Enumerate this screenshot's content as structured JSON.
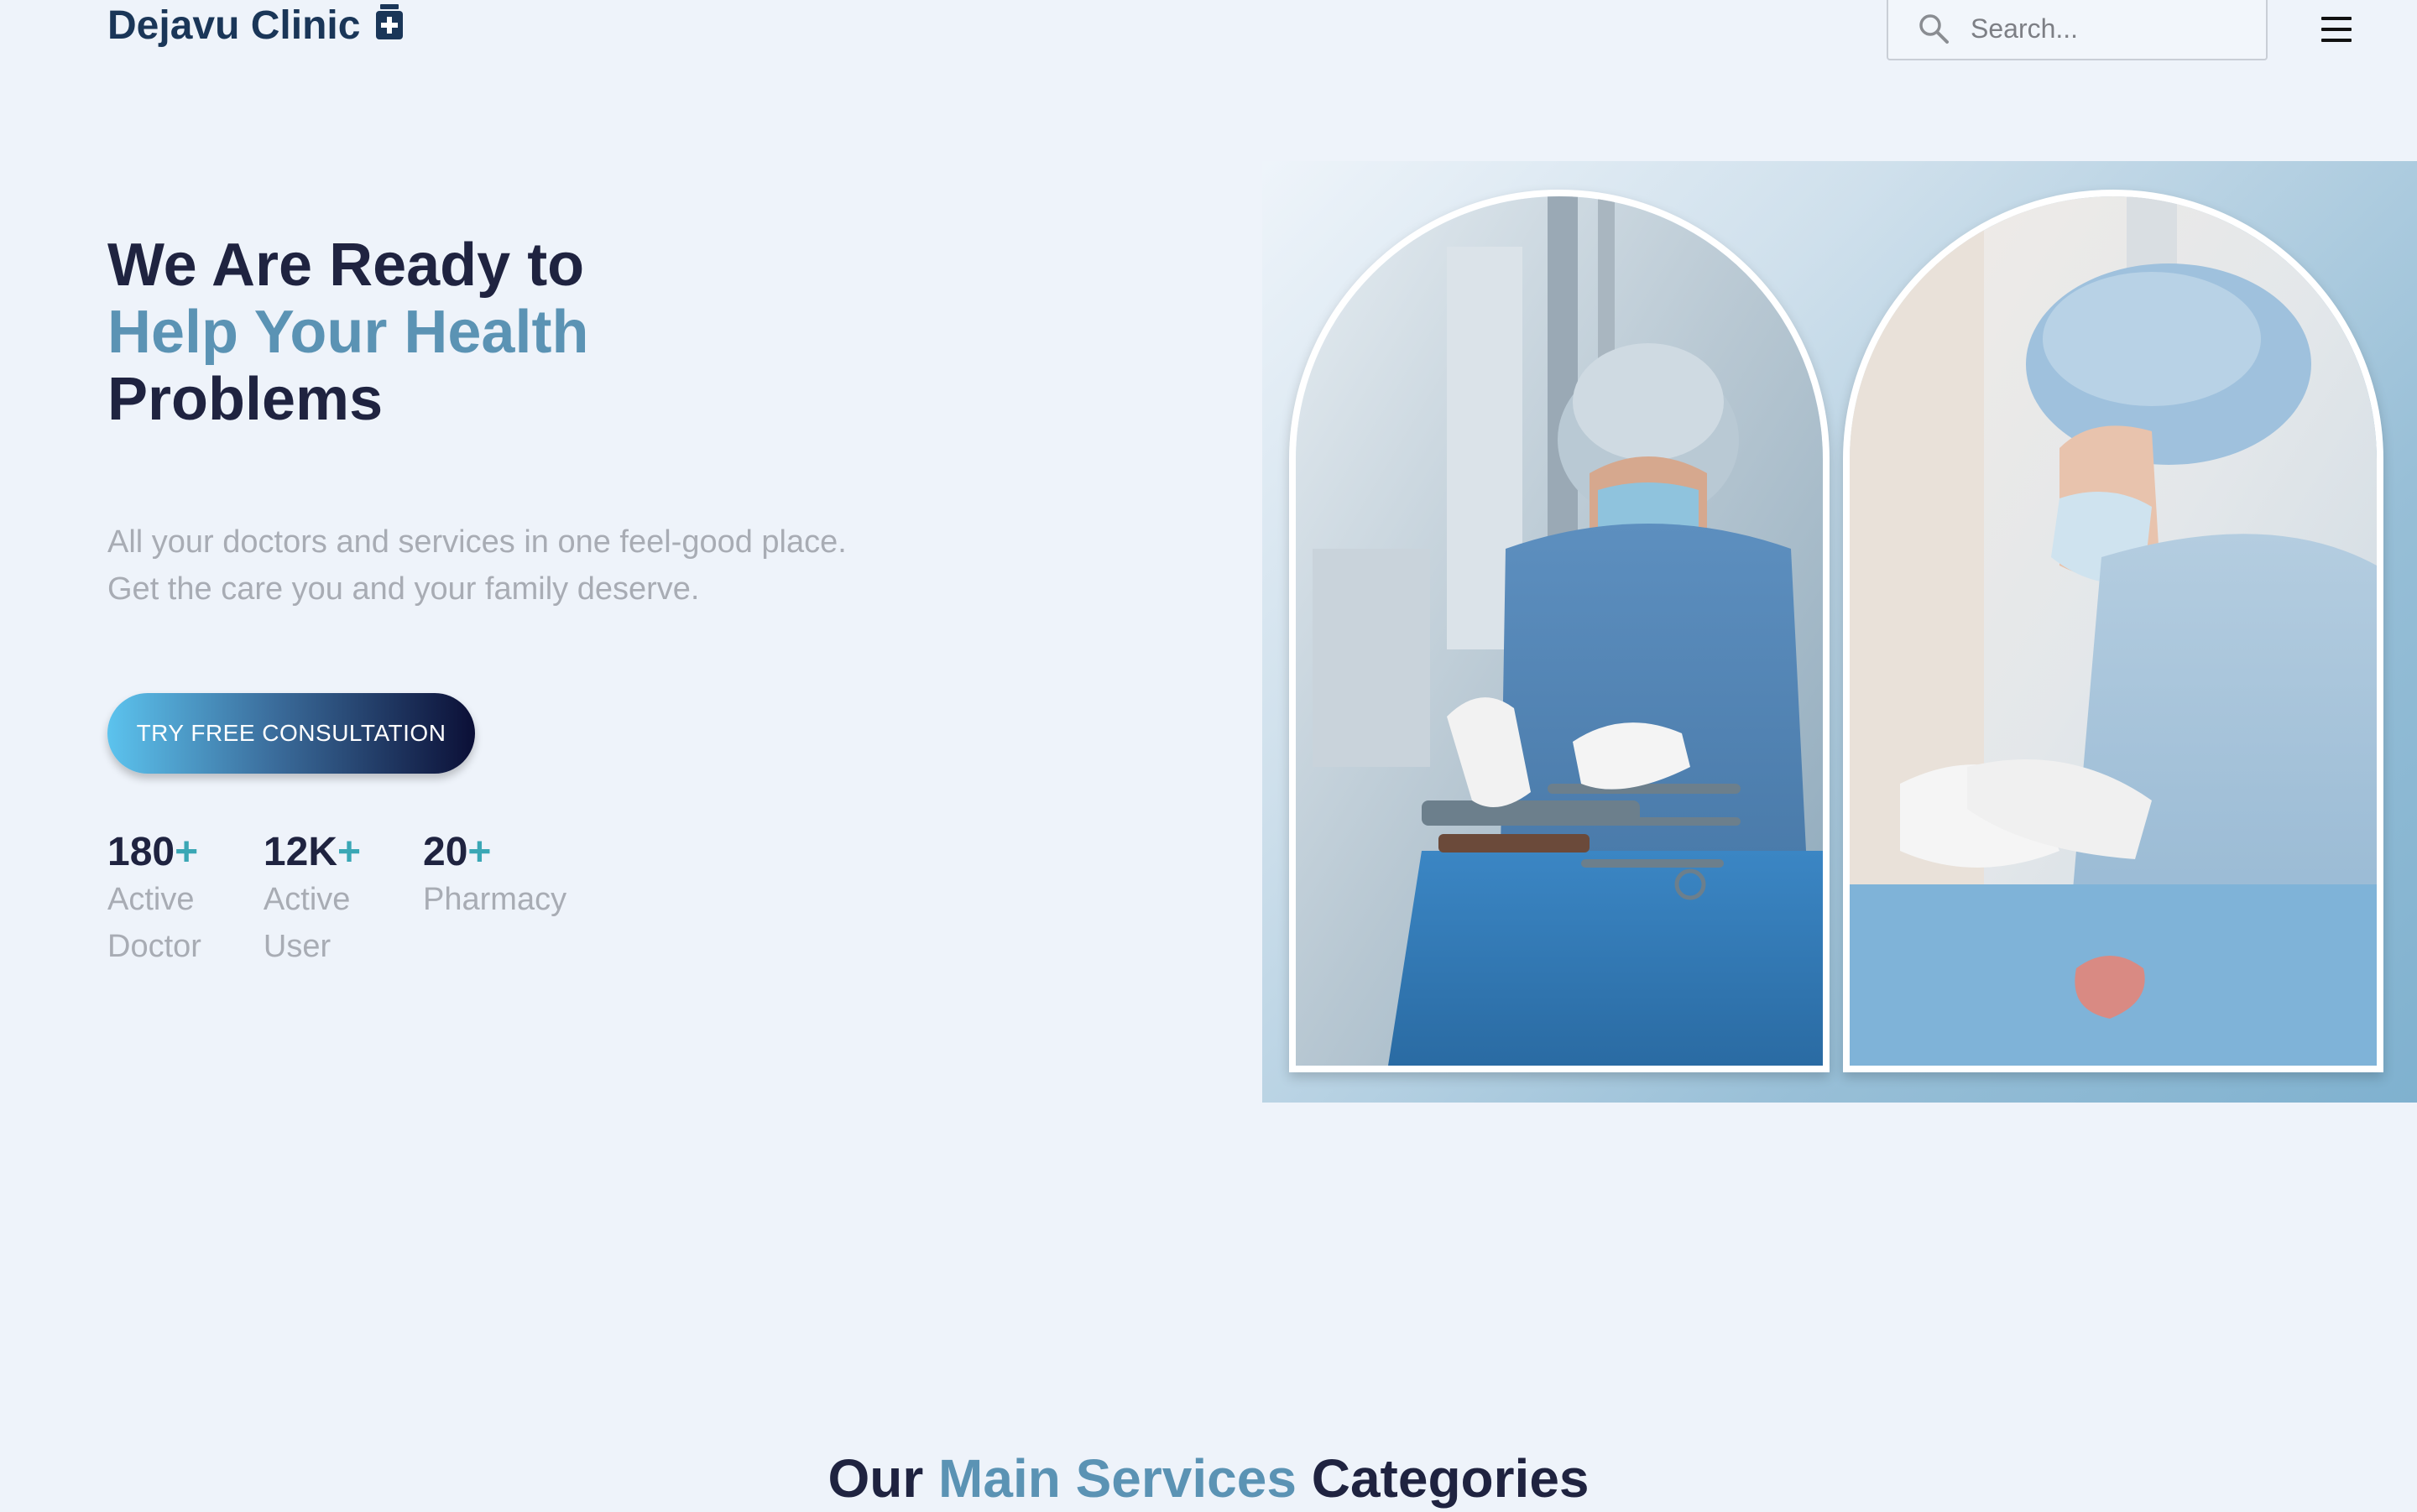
{
  "header": {
    "brand": "Dejavu Clinic",
    "brand_icon": "medical-bag-icon",
    "search_placeholder": "Search...",
    "menu_icon": "hamburger-menu-icon"
  },
  "hero": {
    "title_line1": "We Are Ready to",
    "title_line2": "Help Your Health",
    "title_line3": "Problems",
    "desc_line1": "All your doctors and services in one feel-good place.",
    "desc_line2": "Get the care you and your family deserve.",
    "cta_label": "TRY FREE CONSULTATION",
    "stats": [
      {
        "value": "180",
        "plus": "+",
        "label_line1": "Active",
        "label_line2": "Doctor"
      },
      {
        "value": "12K",
        "plus": "+",
        "label_line1": "Active",
        "label_line2": "User"
      },
      {
        "value": "20",
        "plus": "+",
        "label_line1": "Pharmacy",
        "label_line2": ""
      }
    ],
    "images": [
      "surgeon-at-instrument-table-photo",
      "surgeon-operating-photo"
    ]
  },
  "services": {
    "title_prefix": "Our",
    "title_accent": "Main Services",
    "title_suffix": "Categories"
  },
  "colors": {
    "background": "#eef3fa",
    "brand": "#1a3658",
    "accent": "#5b93b4",
    "heading": "#1f2340",
    "muted_text": "#a8acb4",
    "stat_plus": "#3aa7b5",
    "cta_gradient_start": "#5cc3ee",
    "cta_gradient_end": "#0b0f36"
  }
}
